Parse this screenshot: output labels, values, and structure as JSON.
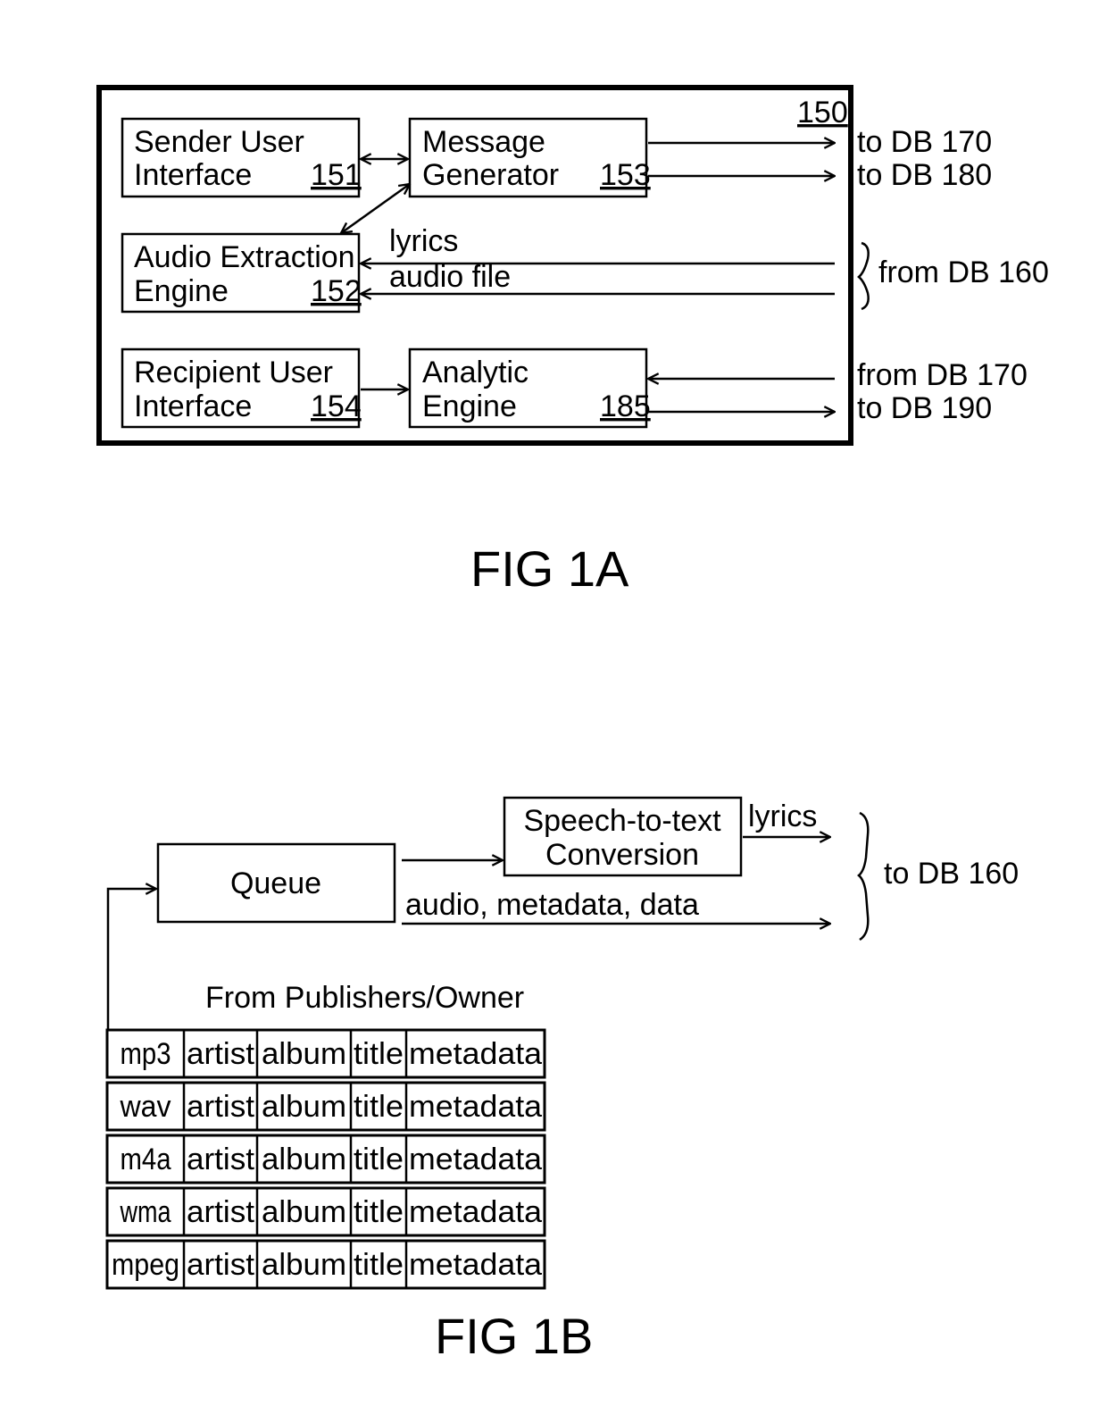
{
  "fig1a": {
    "label": "FIG 1A",
    "system_ref": "150",
    "blocks": {
      "sender_ui": {
        "line1": "Sender User",
        "line2": "Interface",
        "ref": "151"
      },
      "message_generator": {
        "line1": "Message",
        "line2": "Generator",
        "ref": "153"
      },
      "audio_extraction": {
        "line1": "Audio Extraction",
        "line2": "Engine",
        "ref": "152"
      },
      "recipient_ui": {
        "line1": "Recipient User",
        "line2": "Interface",
        "ref": "154"
      },
      "analytic_engine": {
        "line1": "Analytic",
        "line2": "Engine",
        "ref": "185"
      }
    },
    "signals": {
      "lyrics": "lyrics",
      "audio_file": "audio file"
    },
    "external": {
      "to_db_170": "to DB 170",
      "to_db_180": "to DB 180",
      "from_db_160": "from DB 160",
      "from_db_170": "from DB 170",
      "to_db_190": "to DB 190"
    }
  },
  "fig1b": {
    "label": "FIG 1B",
    "queue": "Queue",
    "speech_to_text": {
      "line1": "Speech-to-text",
      "line2": "Conversion"
    },
    "lyrics": "lyrics",
    "audio_metadata_data": "audio, metadata, data",
    "to_db_160": "to DB 160",
    "source_label": "From Publishers/Owner",
    "table": [
      [
        "mp3",
        "artist",
        "album",
        "title",
        "metadata"
      ],
      [
        "wav",
        "artist",
        "album",
        "title",
        "metadata"
      ],
      [
        "m4a",
        "artist",
        "album",
        "title",
        "metadata"
      ],
      [
        "wma",
        "artist",
        "album",
        "title",
        "metadata"
      ],
      [
        "mpeg",
        "artist",
        "album",
        "title",
        "metadata"
      ]
    ]
  }
}
